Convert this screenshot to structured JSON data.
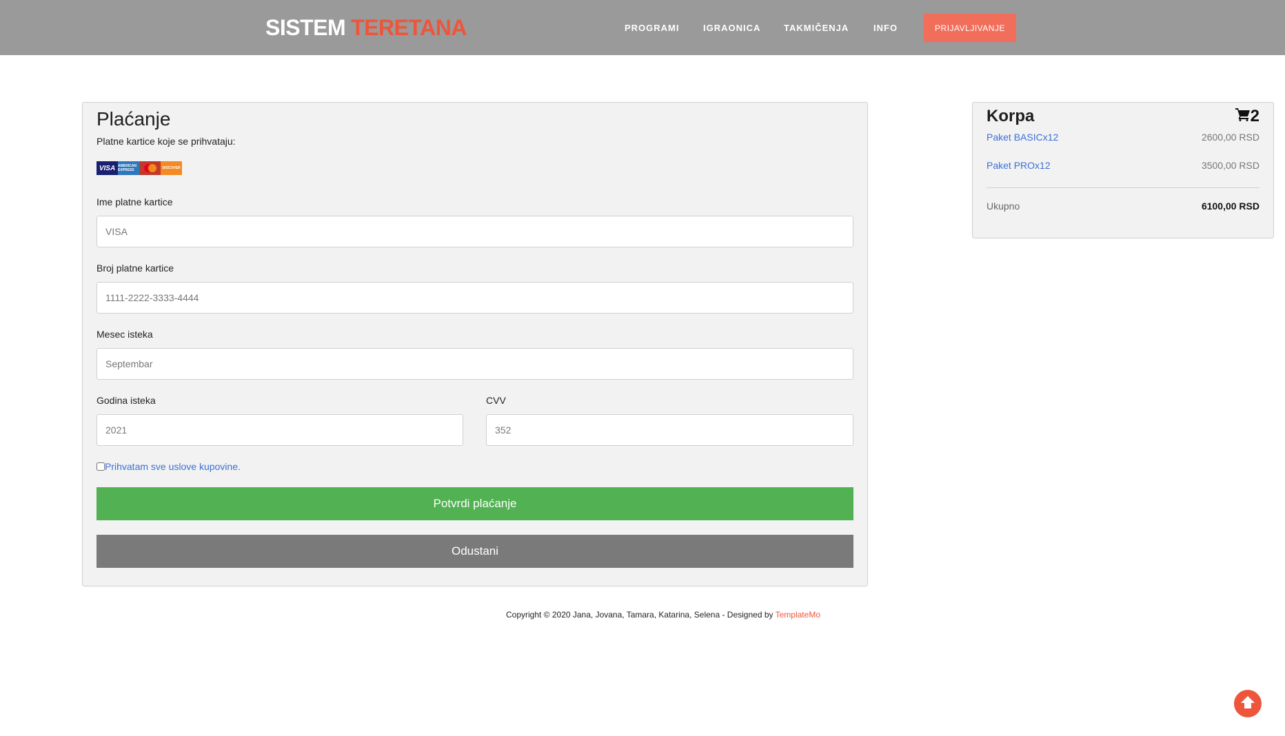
{
  "header": {
    "brand_part1": "SISTEM",
    "brand_part2": "TERETANA",
    "nav": [
      "PROGRAMI",
      "IGRAONICA",
      "TAKMIČENJA",
      "INFO"
    ],
    "login_label": "PRIJAVLJIVANJE"
  },
  "payment": {
    "title": "Plaćanje",
    "accepted_cards_label": "Platne kartice koje se prihvataju:",
    "card_brands": [
      "VISA",
      "AMERICAN EXPRESS",
      "MasterCard",
      "DISCOVER"
    ],
    "card_name_label": "Ime platne kartice",
    "card_name_placeholder": "VISA",
    "card_number_label": "Broj platne kartice",
    "card_number_placeholder": "1111-2222-3333-4444",
    "exp_month_label": "Mesec isteka",
    "exp_month_placeholder": "Septembar",
    "exp_year_label": "Godina isteka",
    "exp_year_placeholder": "2021",
    "cvv_label": "CVV",
    "cvv_placeholder": "352",
    "terms_label": "Prihvatam sve uslove kupovine.",
    "confirm_label": "Potvrdi plaćanje",
    "cancel_label": "Odustani"
  },
  "cart": {
    "title": "Korpa",
    "count": "2",
    "items": [
      {
        "name": "Paket BASICx12",
        "price": "2600,00 RSD"
      },
      {
        "name": "Paket PROx12",
        "price": "3500,00 RSD"
      }
    ],
    "total_label": "Ukupno",
    "total_value": "6100,00 RSD"
  },
  "footer": {
    "text": "Copyright © 2020 Jana, Jovana, Tamara, Katarina, Selena - Designed by ",
    "link": "TemplateMo"
  },
  "colors": {
    "accent": "#ed563b",
    "header_bg": "#9a9a9a",
    "confirm_bg": "#52b152",
    "cancel_bg": "#7a7a7a",
    "link": "#3a6fd8"
  },
  "icons": {
    "cart": "cart-icon",
    "scroll_top": "arrow-up-circle-icon"
  }
}
